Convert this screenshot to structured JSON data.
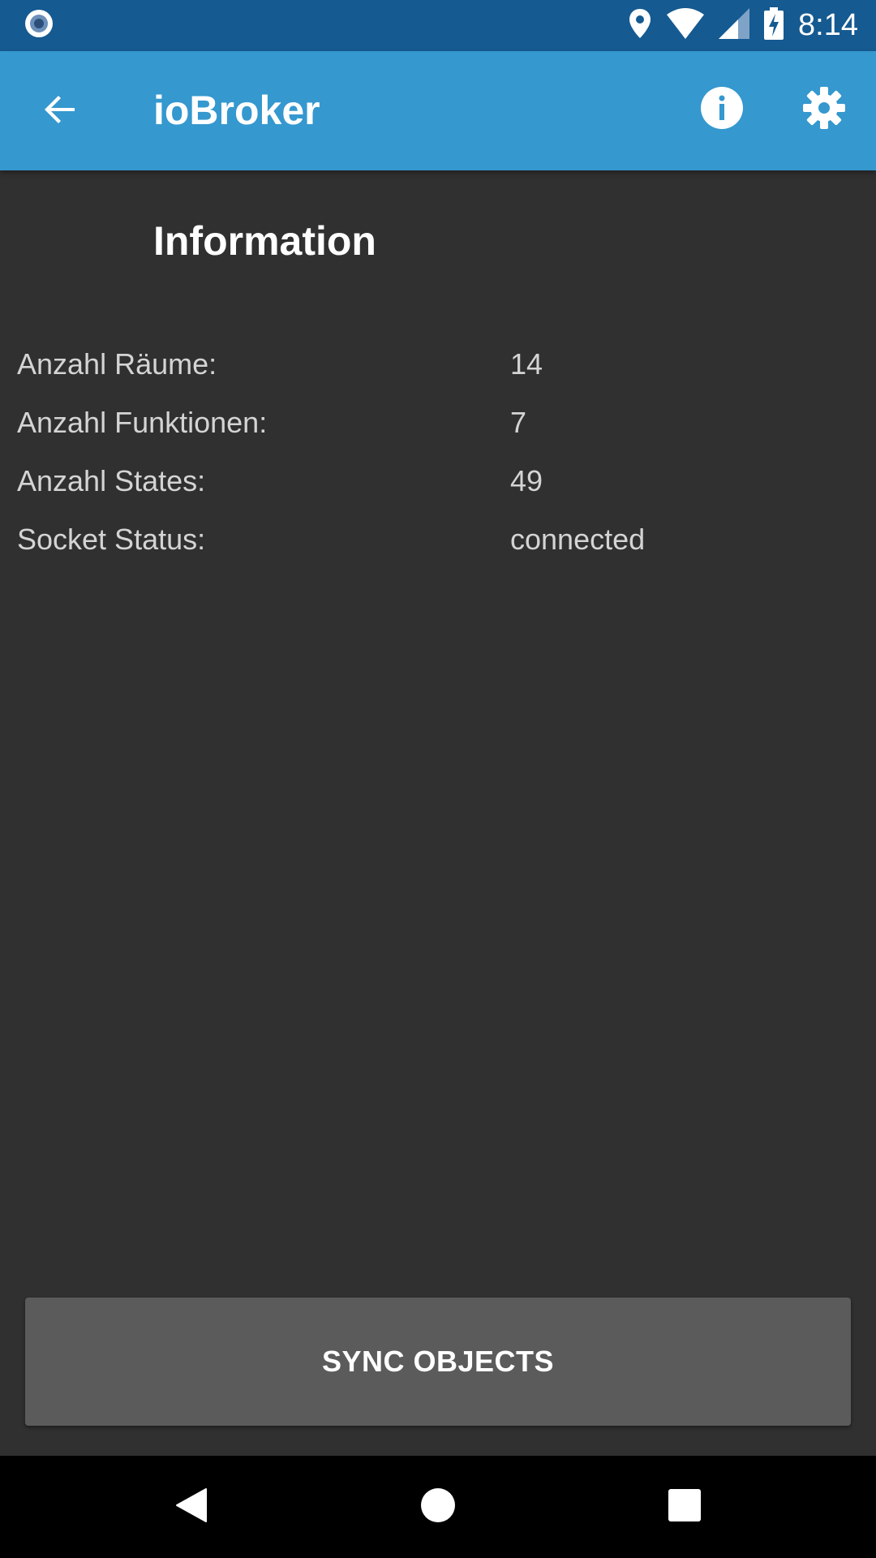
{
  "status_bar": {
    "time": "8:14",
    "icons": [
      "notification-dot-icon",
      "location-icon",
      "wifi-icon",
      "signal-icon",
      "battery-charging-icon"
    ]
  },
  "app_bar": {
    "title": "ioBroker",
    "back_icon": "arrow-back-icon",
    "actions": [
      "info-icon",
      "settings-gear-icon"
    ]
  },
  "main": {
    "section_title": "Information",
    "rows": [
      {
        "label": "Anzahl Räume:",
        "value": "14"
      },
      {
        "label": "Anzahl Funktionen:",
        "value": "7"
      },
      {
        "label": "Anzahl States:",
        "value": "49"
      },
      {
        "label": "Socket Status:",
        "value": "connected"
      }
    ],
    "sync_button_label": "SYNC OBJECTS"
  },
  "nav_bar": {
    "icons": [
      "nav-back-icon",
      "nav-home-icon",
      "nav-recents-icon"
    ]
  },
  "colors": {
    "status_bar": "#155a91",
    "app_bar": "#3598cf",
    "background": "#303030",
    "button": "#5b5b5b"
  }
}
